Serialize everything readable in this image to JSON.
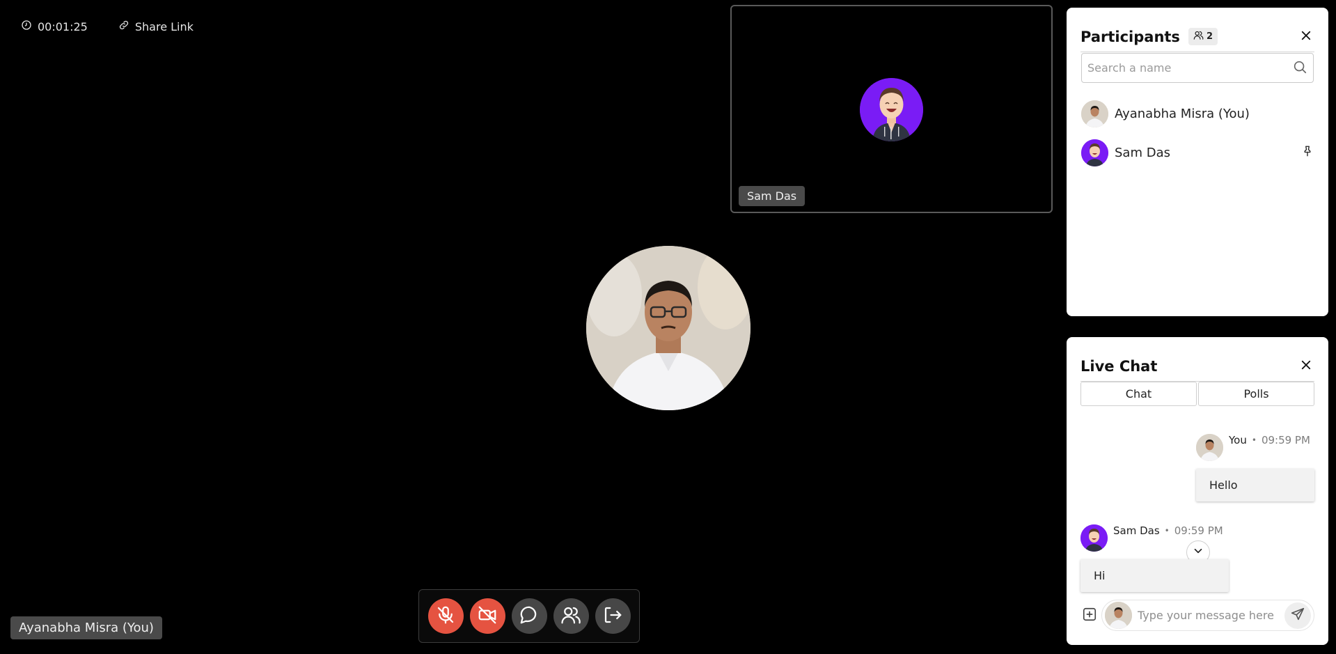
{
  "meeting": {
    "timer": "00:01:25",
    "share_link_label": "Share Link",
    "timer_icon": "clock-icon",
    "share_icon": "link-icon"
  },
  "remote_tile": {
    "name": "Sam Das"
  },
  "self_tile": {
    "name": "Ayanabha Misra (You)"
  },
  "controls": [
    {
      "name": "mic-off",
      "icon": "mic-off-icon",
      "color": "#e55341"
    },
    {
      "name": "camera-off",
      "icon": "video-off-icon",
      "color": "#e55341"
    },
    {
      "name": "chat",
      "icon": "chat-bubble-icon",
      "color": "#474747"
    },
    {
      "name": "participants",
      "icon": "users-icon",
      "color": "#474747"
    },
    {
      "name": "leave",
      "icon": "exit-icon",
      "color": "#474747"
    }
  ],
  "participants_panel": {
    "title": "Participants",
    "count": "2",
    "search_placeholder": "Search a name",
    "items": [
      {
        "name": "Ayanabha Misra (You)",
        "avatar": "avatar-photo",
        "pinned": false
      },
      {
        "name": "Sam Das",
        "avatar": "avatar-cartoon",
        "pinned": true
      }
    ]
  },
  "chat_panel": {
    "title": "Live Chat",
    "tabs": [
      "Chat",
      "Polls"
    ],
    "active_tab": "Chat",
    "messages": [
      {
        "sender": "You",
        "time": "09:59 PM",
        "text": "Hello",
        "align": "right"
      },
      {
        "sender": "Sam Das",
        "time": "09:59 PM",
        "text": "Hi",
        "align": "left"
      }
    ],
    "input_placeholder": "Type your message here"
  },
  "colors": {
    "background": "#000000",
    "danger": "#e55341",
    "control_gray": "#474747",
    "avatar_purple": "#7a1cf5"
  }
}
